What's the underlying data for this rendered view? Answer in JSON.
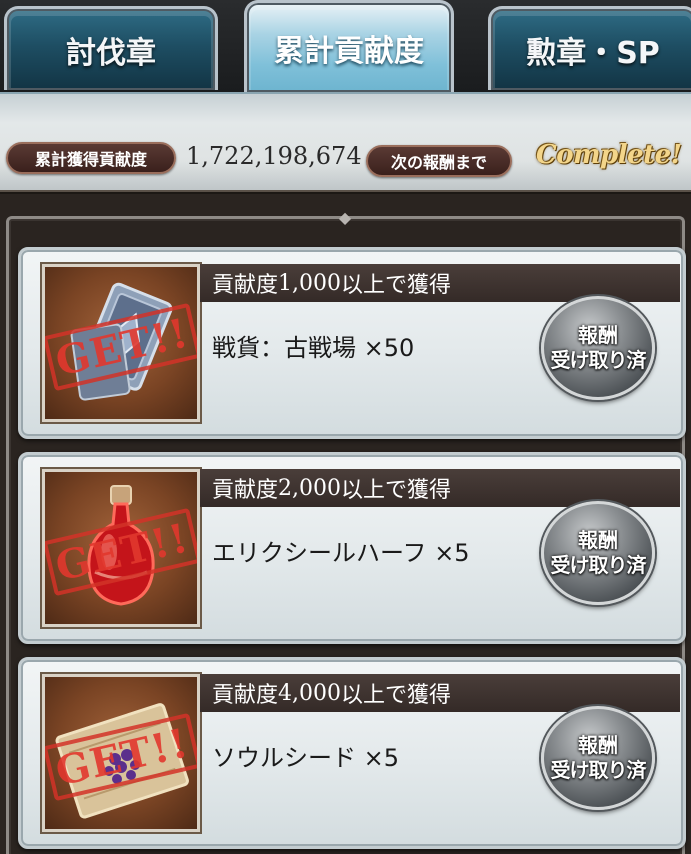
{
  "tabs": [
    {
      "label": "討伐章",
      "active": false
    },
    {
      "label": "累計貢献度",
      "active": true
    },
    {
      "label": "勲章・SP",
      "active": false
    }
  ],
  "status": {
    "total_label": "累計獲得貢献度",
    "total_value": "1,722,198,674",
    "next_label": "次の報酬まで",
    "next_value": "Complete!"
  },
  "rewards": [
    {
      "condition_prefix": "貢献度",
      "condition_number": "1,000",
      "condition_suffix": "以上で獲得",
      "item": "戦貨：古戦場 ×50",
      "icon": "war-chip-card-icon",
      "stamp": "GET!!",
      "button_line1": "報酬",
      "button_line2": "受け取り済"
    },
    {
      "condition_prefix": "貢献度",
      "condition_number": "2,000",
      "condition_suffix": "以上で獲得",
      "item": "エリクシールハーフ ×5",
      "icon": "elixir-half-potion-icon",
      "stamp": "GET!!",
      "button_line1": "報酬",
      "button_line2": "受け取り済"
    },
    {
      "condition_prefix": "貢献度",
      "condition_number": "4,000",
      "condition_suffix": "以上で獲得",
      "item": "ソウルシード ×5",
      "icon": "soul-seed-pouch-icon",
      "stamp": "GET!!",
      "button_line1": "報酬",
      "button_line2": "受け取り済"
    }
  ],
  "colors": {
    "active_tab": "#7fc0d9",
    "inactive_tab": "#1e4e63",
    "condition_bar": "#3e3330",
    "stamp_red": "#e0372d",
    "complete_gold": "#f3d58a"
  }
}
